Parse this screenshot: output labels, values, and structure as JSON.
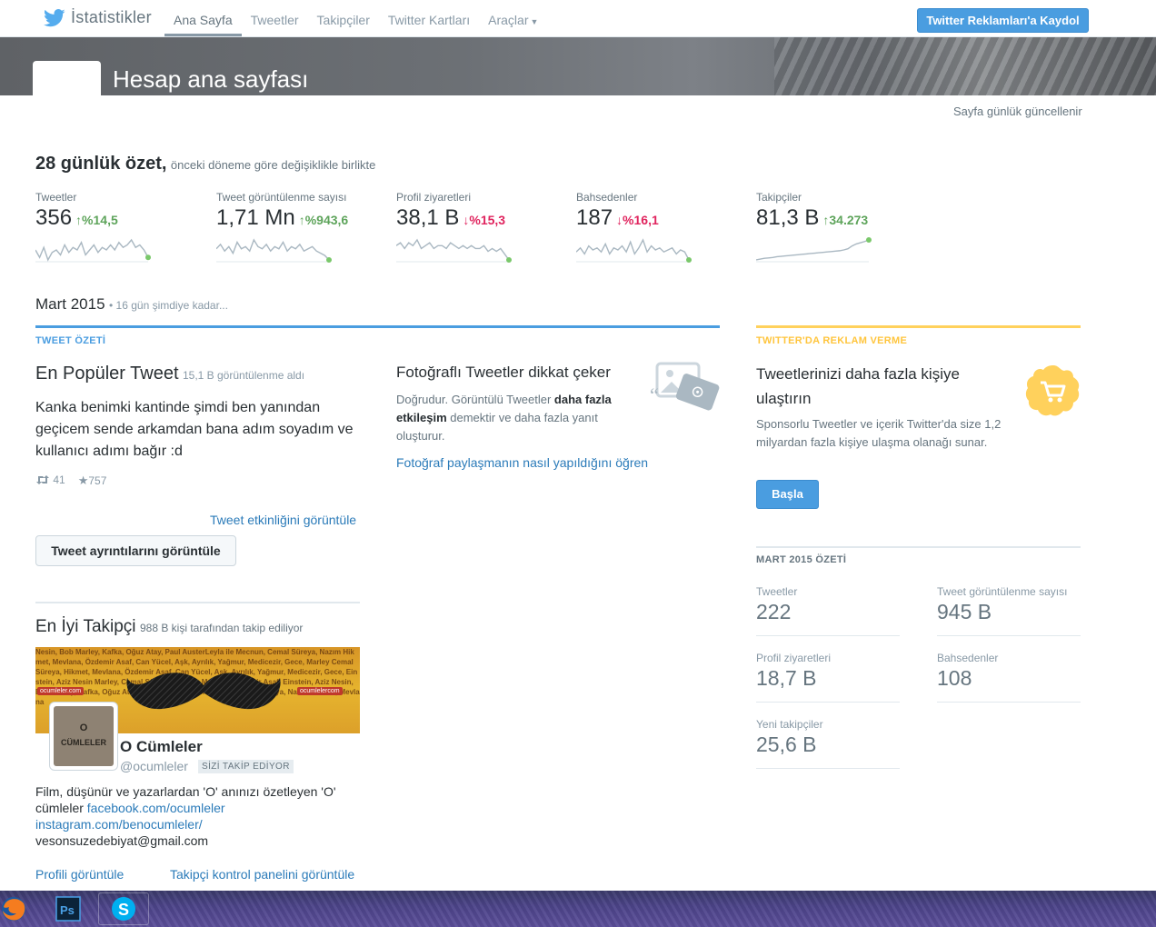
{
  "nav": {
    "brand": "İstatistikler",
    "tabs": [
      {
        "label": "Ana Sayfa",
        "active": true
      },
      {
        "label": "Tweetler"
      },
      {
        "label": "Takipçiler"
      },
      {
        "label": "Twitter Kartları"
      },
      {
        "label": "Araçlar"
      }
    ],
    "ads_button": "Twitter Reklamları'a Kaydol"
  },
  "banner": {
    "title": "Hesap ana sayfası"
  },
  "updated_note": "Sayfa günlük güncellenir",
  "summary": {
    "title": "28 günlük özet,",
    "subtitle": "önceki döneme göre değişiklikle birlikte",
    "metrics": [
      {
        "label": "Tweetler",
        "value": "356",
        "change": "%14,5",
        "direction": "up",
        "trend": [
          6,
          3,
          7,
          2,
          5,
          6,
          4,
          8,
          5,
          7,
          6,
          9,
          4,
          6,
          8,
          5,
          7,
          6,
          8,
          6,
          9,
          7,
          8,
          10,
          7,
          8,
          6,
          3
        ]
      },
      {
        "label": "Tweet görüntülenme sayısı",
        "value": "1,71 Mn",
        "change": "%943,6",
        "direction": "up",
        "trend": [
          5,
          7,
          4,
          6,
          3,
          8,
          5,
          6,
          4,
          9,
          6,
          5,
          7,
          4,
          6,
          5,
          8,
          4,
          6,
          5,
          7,
          4,
          5,
          6,
          4,
          3,
          2,
          0
        ]
      },
      {
        "label": "Profil ziyaretleri",
        "value": "38,1 B",
        "change": "%15,3",
        "direction": "down",
        "trend": [
          5,
          6,
          4,
          6,
          5,
          7,
          4,
          5,
          6,
          4,
          5,
          5,
          4,
          6,
          5,
          4,
          5,
          4,
          5,
          4,
          4,
          5,
          3,
          4,
          3,
          4,
          2,
          0
        ]
      },
      {
        "label": "Bahsedenler",
        "value": "187",
        "change": "%16,1",
        "direction": "down",
        "trend": [
          4,
          6,
          3,
          7,
          5,
          6,
          4,
          8,
          3,
          6,
          5,
          7,
          4,
          9,
          3,
          6,
          10,
          4,
          7,
          5,
          6,
          4,
          5,
          6,
          3,
          5,
          4,
          0
        ]
      },
      {
        "label": "Takipçiler",
        "value": "81,3 B",
        "change": "34.273",
        "direction": "up",
        "trend": [
          1,
          1.2,
          1.4,
          1.5,
          1.6,
          1.8,
          1.9,
          2,
          2.1,
          2.2,
          2.3,
          2.4,
          2.5,
          2.6,
          2.7,
          2.8,
          2.9,
          3,
          3.1,
          3.2,
          3.3,
          3.5,
          3.8,
          4.5,
          5,
          5.3,
          5.6,
          6
        ]
      }
    ]
  },
  "month": {
    "title": "Mart 2015",
    "subtitle": "• 16 gün şimdiye kadar..."
  },
  "tweet_summary": {
    "section_label": "TWEET ÖZETİ",
    "top_tweet_title": "En Popüler Tweet",
    "top_tweet_views": "15,1 B görüntülenme aldı",
    "top_tweet_text": "Kanka benimki kantinde şimdi ben yanından geçicem sende arkamdan bana adım soyadım ve kullanıcı adımı bağır :d",
    "retweets": "41",
    "favorites": "757",
    "activity_link": "Tweet etkinliğini görüntüle",
    "details_button": "Tweet ayrıntılarını görüntüle"
  },
  "photo_tip": {
    "title": "Fotoğraflı Tweetler dikkat çeker",
    "text_a": "Doğrudur. Görüntülü Tweetler ",
    "text_bold": "daha fazla etkileşim",
    "text_b": " demektir ve daha fazla yanıt oluşturur.",
    "link": "Fotoğraf paylaşmanın nasıl yapıldığını öğren"
  },
  "top_follower": {
    "title": "En İyi Takipçi",
    "subtitle": "988 B kişi tarafından takip ediliyor",
    "cover_words": "Nesin, Bob Marley, Kafka, Oğuz Atay, Paul AusterLeyla ile Mecnun, Cemal Süreya, Nazım Hikmet, Mevlana, Özdemir Asaf, Can Yücel, Aşk, Ayrılık, Yağmur, Medicezir, Gece, Marley Cemal Süreya, Hikmet, Mevlana, Özdemir Asaf, Can Yücel, Aşk, Ayrılık, Yağmur, Medicezir, Gece, Einstein, Aziz Nesin Marley, Cemal Süreya, Hikmet, Mevlana Özdemir Asaf, Einstein, Aziz Nesin, Bob Marley, Kafka, Oğuz Atay, Paul Auster, Özdemir Asaf, Cemal Süreya, Nazım Hikmet, Mevlana",
    "cover_tag_left": "ocumleler.com",
    "cover_tag_right": "ocumlelercom",
    "avatar_line1": "O",
    "avatar_line2": "CÜMLELER",
    "name": "O Cümleler",
    "handle": "@ocumleler",
    "badge": "SİZİ TAKİP EDİYOR",
    "bio_text": "Film, düşünür ve yazarlardan 'O' anınızı özetleyen 'O' cümleler ",
    "bio_link1": "facebook.com/ocumleler",
    "bio_link2": "instagram.com/benocumleler/",
    "bio_email": "vesonsuzedebiyat@gmail.com",
    "profile_link": "Profili görüntüle",
    "dashboard_link": "Takipçi kontrol panelini görüntüle"
  },
  "ads": {
    "section_label": "TWITTER'DA REKLAM VERME",
    "title": "Tweetlerinizi daha fazla kişiye ulaştırın",
    "text": "Sponsorlu Tweetler ve içerik Twitter'da size 1,2 milyardan fazla kişiye ulaşma olanağı sunar.",
    "button": "Başla"
  },
  "march_summary": {
    "title": "MART 2015 ÖZETİ",
    "stats": [
      {
        "label": "Tweetler",
        "value": "222"
      },
      {
        "label": "Tweet görüntülenme sayısı",
        "value": "945 B"
      },
      {
        "label": "Profil ziyaretleri",
        "value": "18,7 B"
      },
      {
        "label": "Bahsedenler",
        "value": "108"
      },
      {
        "label": "Yeni takipçiler",
        "value": "25,6 B"
      }
    ]
  },
  "colors": {
    "accent_blue": "#4a9de0",
    "up_green": "#5ea45b",
    "down_red": "#e0245e",
    "ads_yellow": "#ffd15c"
  },
  "taskbar": {
    "apps": [
      "firefox-icon",
      "photoshop-icon",
      "skype-icon"
    ],
    "ps_label": "Ps"
  }
}
